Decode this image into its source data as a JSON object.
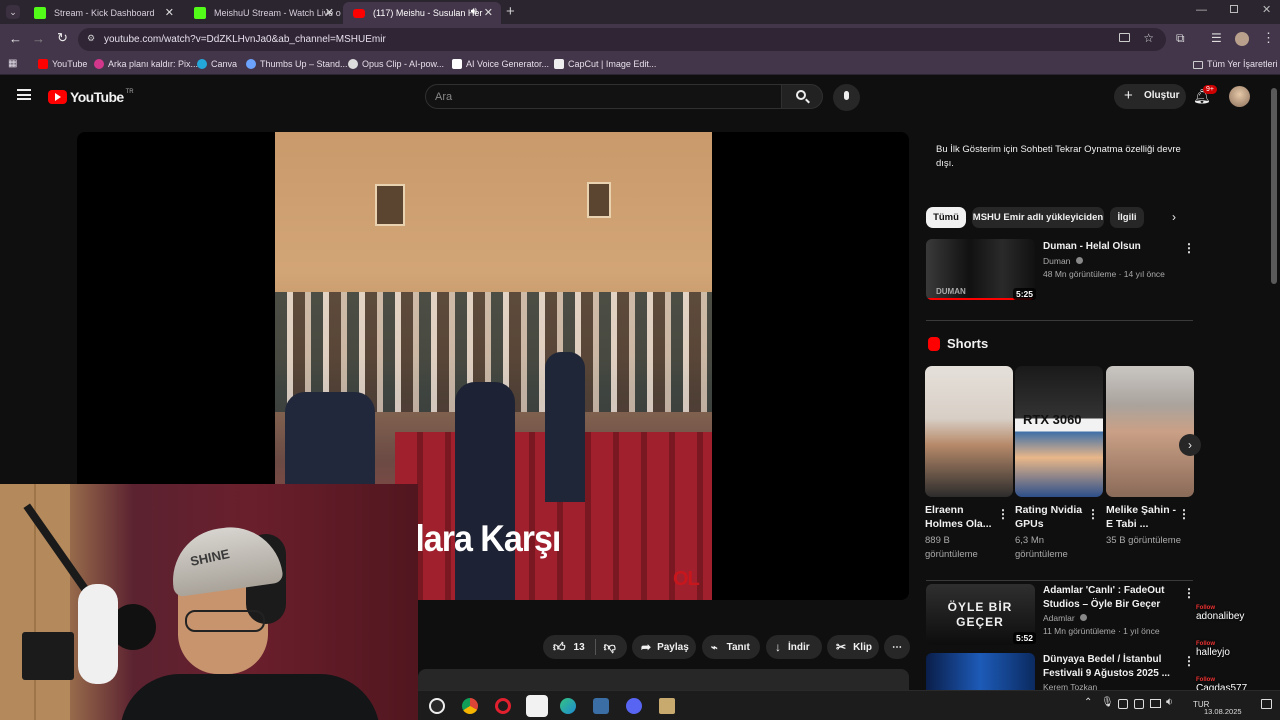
{
  "browser": {
    "tabs": [
      {
        "title": "Stream - Kick Dashboard",
        "favicon_color": "#53fc18"
      },
      {
        "title": "MeishuU Stream - Watch Live o",
        "favicon_color": "#53fc18"
      },
      {
        "title": "(117) Meishu - Susulan Her",
        "favicon_color": "#ff0000"
      }
    ],
    "url": "youtube.com/watch?v=DdZKLHvnJa0&ab_channel=MSHUEmir",
    "bookmarks": [
      "YouTube",
      "Arka planı kaldır: Pix...",
      "Canva",
      "Thumbs Up – Stand...",
      "Opus Clip - AI-pow...",
      "AI Voice Generator...",
      "CapCut | Image Edit..."
    ],
    "all_bookmarks": "Tüm Yer İşaretleri"
  },
  "youtube": {
    "logo": "YouTube",
    "country": "TR",
    "search_placeholder": "Ara",
    "create_label": "Oluştur",
    "notif_badge": "9+"
  },
  "video": {
    "caption": "uşanlara Karşı",
    "watermark": "OL",
    "likes": "13",
    "share_label": "Paylaş",
    "promote_label": "Tanıt",
    "download_label": "İndir",
    "clip_label": "Klip"
  },
  "sidebar": {
    "chat_notice": "Bu İlk Gösterim için Sohbeti Tekrar Oynatma özelliği devre dışı.",
    "chips": [
      "Tümü",
      "MSHU Emir adlı yükleyiciden",
      "İlgili"
    ],
    "top_video": {
      "title": "Duman - Helal Olsun",
      "channel": "Duman",
      "meta": "48 Mn görüntüleme · 14 yıl önce",
      "duration": "5:25",
      "thumb_text": "DUMAN"
    },
    "shorts_heading": "Shorts",
    "shorts": [
      {
        "title": "Elraenn Holmes Ola...",
        "views": "889 B görüntüleme"
      },
      {
        "title": "Rating Nvidia GPUs",
        "views": "6,3 Mn görüntüleme",
        "thumb_text": "RTX 3060"
      },
      {
        "title": "Melike Şahin - E Tabi ...",
        "views": "35 B görüntüleme"
      }
    ],
    "videos": [
      {
        "title": "Adamlar 'Canlı' : FadeOut Studios – Öyle Bir Geçer",
        "channel": "Adamlar",
        "meta": "11 Mn görüntüleme · 1 yıl önce",
        "duration": "5:52",
        "thumb_text": "ÖYLE BİR GEÇER"
      },
      {
        "title": "Dünyaya Bedel / İstanbul Festivali 9 Ağustos 2025 ...",
        "channel": "Kerem Tozkan"
      }
    ]
  },
  "overlay": {
    "follow_label": "Follow",
    "followers": [
      "adonalibey",
      "halleyjo",
      "Cagdas577"
    ],
    "cap_text": "SHINE"
  },
  "taskbar": {
    "lang": "TUR",
    "date": "13.08.2025"
  }
}
